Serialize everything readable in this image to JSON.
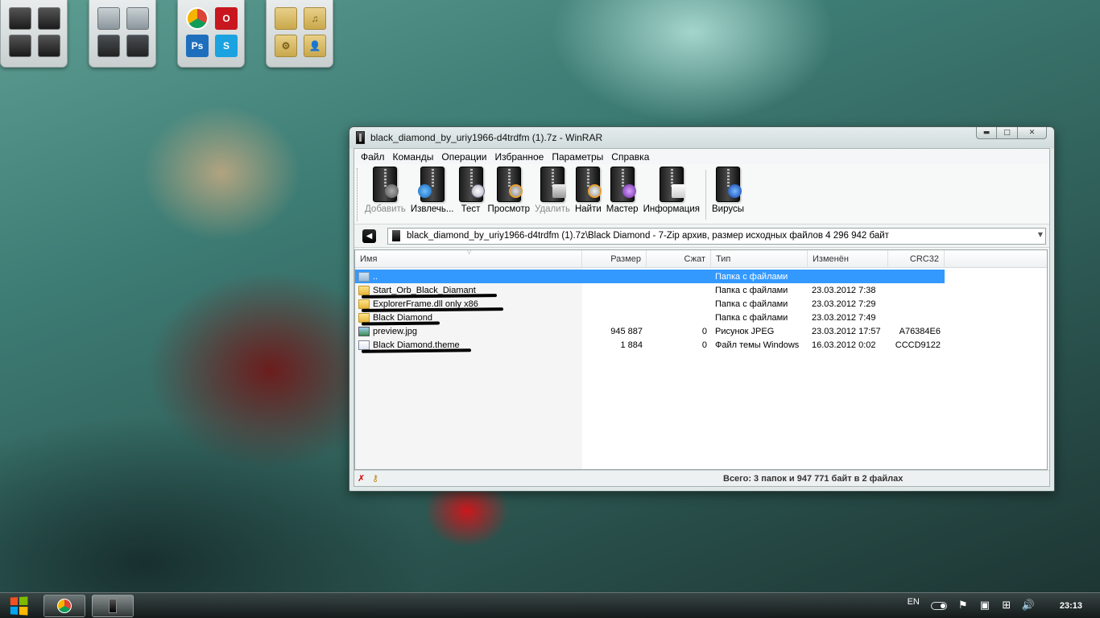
{
  "window": {
    "title": "black_diamond_by_uriy1966-d4trdfm (1).7z - WinRAR",
    "controls": {
      "minimize": "▬",
      "maximize": "□",
      "close": "✕"
    }
  },
  "menu": [
    "Файл",
    "Команды",
    "Операции",
    "Избранное",
    "Параметры",
    "Справка"
  ],
  "toolbar": [
    {
      "label": "Добавить",
      "icon": "add-icon",
      "disabled": true
    },
    {
      "label": "Извлечь...",
      "icon": "extract-icon",
      "disabled": false
    },
    {
      "label": "Тест",
      "icon": "test-icon",
      "disabled": false
    },
    {
      "label": "Просмотр",
      "icon": "view-icon",
      "disabled": false
    },
    {
      "label": "Удалить",
      "icon": "delete-icon",
      "disabled": true
    },
    {
      "label": "Найти",
      "icon": "find-icon",
      "disabled": false
    },
    {
      "label": "Мастер",
      "icon": "wizard-icon",
      "disabled": false
    },
    {
      "label": "Информация",
      "icon": "info-icon",
      "disabled": false
    },
    {
      "label": "Вирусы",
      "icon": "virus-scan-icon",
      "disabled": false
    }
  ],
  "address": {
    "path": "black_diamond_by_uriy1966-d4trdfm (1).7z\\Black Diamond - 7-Zip архив, размер исходных файлов 4 296 942 байт"
  },
  "columns": {
    "name": "Имя",
    "size": "Размер",
    "packed": "Сжат",
    "type": "Тип",
    "modified": "Изменён",
    "crc": "CRC32"
  },
  "files": [
    {
      "name": "..",
      "size": "",
      "packed": "",
      "type": "Папка с файлами",
      "modified": "",
      "crc": "",
      "icon": "folder-up-icon",
      "selected": true
    },
    {
      "name": "Start_Orb_Black_Diamant",
      "size": "",
      "packed": "",
      "type": "Папка с файлами",
      "modified": "23.03.2012 7:38",
      "crc": "",
      "icon": "folder-icon",
      "selected": false
    },
    {
      "name": "ExplorerFrame.dll only x86",
      "size": "",
      "packed": "",
      "type": "Папка с файлами",
      "modified": "23.03.2012 7:29",
      "crc": "",
      "icon": "folder-icon",
      "selected": false
    },
    {
      "name": "Black Diamond",
      "size": "",
      "packed": "",
      "type": "Папка с файлами",
      "modified": "23.03.2012 7:49",
      "crc": "",
      "icon": "folder-icon",
      "selected": false
    },
    {
      "name": "preview.jpg",
      "size": "945 887",
      "packed": "0",
      "type": "Рисунок JPEG",
      "modified": "23.03.2012 17:57",
      "crc": "A76384E6",
      "icon": "image-file-icon",
      "selected": false
    },
    {
      "name": "Black Diamond.theme",
      "size": "1 884",
      "packed": "0",
      "type": "Файл темы Windows",
      "modified": "16.03.2012 0:02",
      "crc": "CCCD9122",
      "icon": "theme-file-icon",
      "selected": false
    }
  ],
  "status": {
    "text": "Всего: 3 папок и 947 771 байт в 2 файлах"
  },
  "widgets": [
    {
      "name": "games-widget",
      "icons": [
        "",
        "",
        "",
        ""
      ]
    },
    {
      "name": "drives-widget",
      "icons": [
        "",
        "",
        "",
        ""
      ]
    },
    {
      "name": "apps-widget",
      "icons": [
        "",
        "O",
        "Ps",
        "S"
      ]
    },
    {
      "name": "folders-widget",
      "icons": [
        "",
        "♫",
        "⚙",
        "👤"
      ]
    }
  ],
  "taskbar": {
    "language": "EN",
    "clock": "23:13"
  }
}
